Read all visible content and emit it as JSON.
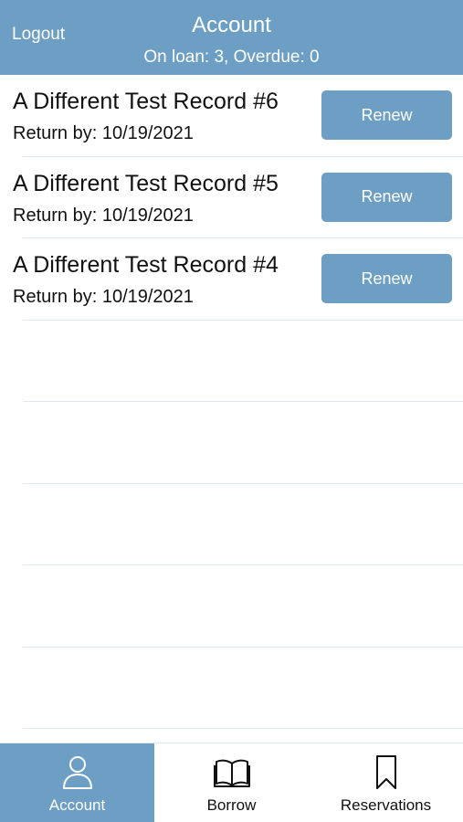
{
  "header": {
    "logout_label": "Logout",
    "title": "Account",
    "subtitle": "On loan: 3, Overdue: 0"
  },
  "loans": [
    {
      "title": "A Different Test Record #6",
      "return_by": "Return by: 10/19/2021",
      "action": "Renew"
    },
    {
      "title": "A Different Test Record #5",
      "return_by": "Return by: 10/19/2021",
      "action": "Renew"
    },
    {
      "title": "A Different Test Record #4",
      "return_by": "Return by: 10/19/2021",
      "action": "Renew"
    }
  ],
  "tabs": [
    {
      "label": "Account",
      "icon": "person-icon",
      "active": true
    },
    {
      "label": "Borrow",
      "icon": "book-icon",
      "active": false
    },
    {
      "label": "Reservations",
      "icon": "bookmark-icon",
      "active": false
    }
  ],
  "colors": {
    "accent": "#6d9ec3",
    "separator": "#dfe8ef",
    "text": "#111111"
  }
}
